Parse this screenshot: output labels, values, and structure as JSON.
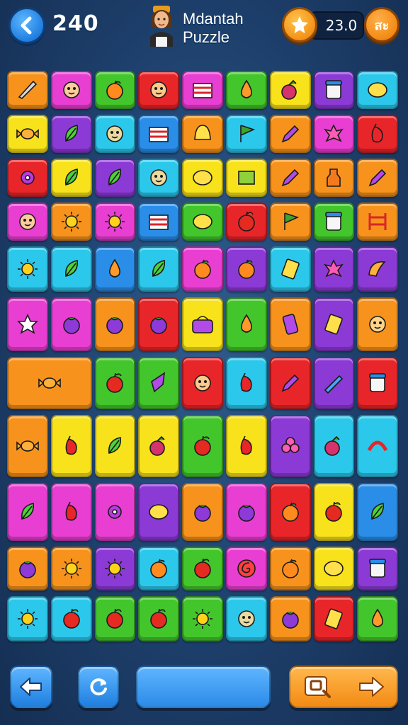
{
  "header": {
    "back_icon": "arrow-left-icon",
    "score": "240",
    "avatar_icon": "player-avatar-icon",
    "title_line1": "Mdantah",
    "title_line2": "Puzzle",
    "star_icon": "star-icon",
    "timer": "23.0",
    "extra_label": "สะ"
  },
  "colors": {
    "orange": "#f7931c",
    "magenta": "#e83fd2",
    "green": "#43c62c",
    "red": "#e8262a",
    "yellow": "#f8e21c",
    "purple": "#8c3ad6",
    "cyan": "#2cc8ec",
    "blue": "#2a8ee8"
  },
  "board": {
    "rows": [
      [
        [
          "orange",
          "knife-icon"
        ],
        [
          "magenta",
          "face-icon"
        ],
        [
          "green",
          "orange-fruit-icon"
        ],
        [
          "red",
          "face-icon"
        ],
        [
          "magenta",
          "cake-icon"
        ],
        [
          "green",
          "drop-icon"
        ],
        [
          "yellow",
          "berry-icon"
        ],
        [
          "purple",
          "jar-icon"
        ],
        [
          "cyan",
          "lemon-icon"
        ]
      ],
      [
        [
          "yellow",
          "candy-icon"
        ],
        [
          "purple",
          "leaf-icon"
        ],
        [
          "cyan",
          "face-icon"
        ],
        [
          "blue",
          "cake-icon"
        ],
        [
          "orange",
          "bell-icon"
        ],
        [
          "cyan",
          "flag-icon"
        ],
        [
          "orange",
          "pencil-icon"
        ],
        [
          "magenta",
          "star-splat-icon"
        ],
        [
          "red",
          "pepper-icon"
        ]
      ],
      [
        [
          "red",
          "gear-icon"
        ],
        [
          "yellow",
          "leaf-icon"
        ],
        [
          "purple",
          "leaf-icon"
        ],
        [
          "cyan",
          "face-icon"
        ],
        [
          "yellow",
          "lemon-icon"
        ],
        [
          "yellow",
          "box-icon"
        ],
        [
          "orange",
          "pencil-icon"
        ],
        [
          "orange",
          "bottle-icon"
        ],
        [
          "orange",
          "pencil-icon"
        ]
      ],
      [
        [
          "magenta",
          "face-icon"
        ],
        [
          "orange",
          "sun-icon"
        ],
        [
          "magenta",
          "sun-icon"
        ],
        [
          "blue",
          "cake-icon"
        ],
        [
          "green",
          "lemon-icon"
        ],
        [
          "red",
          "apple-icon"
        ],
        [
          "orange",
          "flag-icon"
        ],
        [
          "green",
          "jar-icon"
        ],
        [
          "orange",
          "gate-icon"
        ]
      ],
      [
        [
          "cyan",
          "sun-icon"
        ],
        [
          "cyan",
          "leaf-icon"
        ],
        [
          "blue",
          "drop-icon"
        ],
        [
          "cyan",
          "leaf-icon"
        ],
        [
          "magenta",
          "orange-fruit-icon"
        ],
        [
          "purple",
          "orange-fruit-icon"
        ],
        [
          "cyan",
          "card-icon"
        ],
        [
          "purple",
          "star-splat-icon"
        ],
        [
          "purple",
          "croissant-icon"
        ]
      ],
      [
        [
          "magenta",
          "star-icon"
        ],
        [
          "magenta",
          "plum-icon"
        ],
        [
          "orange",
          "plum-icon"
        ],
        [
          "red",
          "plum-icon"
        ],
        [
          "yellow",
          "pot-icon"
        ],
        [
          "green",
          "drop-icon"
        ],
        [
          "orange",
          "phone-icon"
        ],
        [
          "purple",
          "card-icon"
        ],
        [
          "orange",
          "face-icon"
        ]
      ],
      [
        [
          "orange",
          "candy-icon",
          "wide"
        ],
        [
          "green",
          "apple-icon"
        ],
        [
          "green",
          "gem-icon"
        ],
        [
          "red",
          "face-icon"
        ],
        [
          "cyan",
          "pepper-icon"
        ],
        [
          "red",
          "pencil-icon"
        ],
        [
          "purple",
          "brush-icon"
        ],
        [
          "red",
          "jar-icon"
        ]
      ],
      [
        [
          "orange",
          "candy-icon"
        ],
        [
          "yellow",
          "pepper-icon"
        ],
        [
          "yellow",
          "leaf-icon"
        ],
        [
          "yellow",
          "berry-icon"
        ],
        [
          "green",
          "apple-icon"
        ],
        [
          "yellow",
          "pepper-icon"
        ],
        [
          "purple",
          "flower-icon"
        ],
        [
          "cyan",
          "berry-icon"
        ],
        [
          "cyan",
          "rainbow-icon"
        ]
      ],
      [
        [
          "magenta",
          "leaf-icon"
        ],
        [
          "magenta",
          "pepper-icon"
        ],
        [
          "magenta",
          "gear-icon"
        ],
        [
          "purple",
          "lemon-icon"
        ],
        [
          "orange",
          "plum-icon"
        ],
        [
          "magenta",
          "plum-icon"
        ],
        [
          "red",
          "orange-fruit-icon"
        ],
        [
          "yellow",
          "apple-icon"
        ],
        [
          "blue",
          "leaf-icon"
        ]
      ],
      [
        [
          "orange",
          "plum-icon"
        ],
        [
          "orange",
          "sun-icon"
        ],
        [
          "purple",
          "sun-icon"
        ],
        [
          "cyan",
          "orange-fruit-icon"
        ],
        [
          "green",
          "apple-icon"
        ],
        [
          "magenta",
          "swirl-icon"
        ],
        [
          "orange",
          "orange-fruit-icon"
        ],
        [
          "yellow",
          "lemon-icon"
        ],
        [
          "purple",
          "jar-icon"
        ]
      ],
      [
        [
          "cyan",
          "sun-icon"
        ],
        [
          "cyan",
          "apple-icon"
        ],
        [
          "green",
          "apple-icon"
        ],
        [
          "green",
          "apple-icon"
        ],
        [
          "green",
          "sun-icon"
        ],
        [
          "cyan",
          "face-icon"
        ],
        [
          "orange",
          "plum-icon"
        ],
        [
          "red",
          "card-icon"
        ],
        [
          "green",
          "drop-icon"
        ]
      ]
    ]
  },
  "footer": {
    "prev_icon": "arrow-left-icon",
    "refresh_icon": "refresh-icon",
    "progress_icon": "progress-bar",
    "hint_icon": "hint-icon",
    "next_icon": "arrow-right-icon"
  }
}
